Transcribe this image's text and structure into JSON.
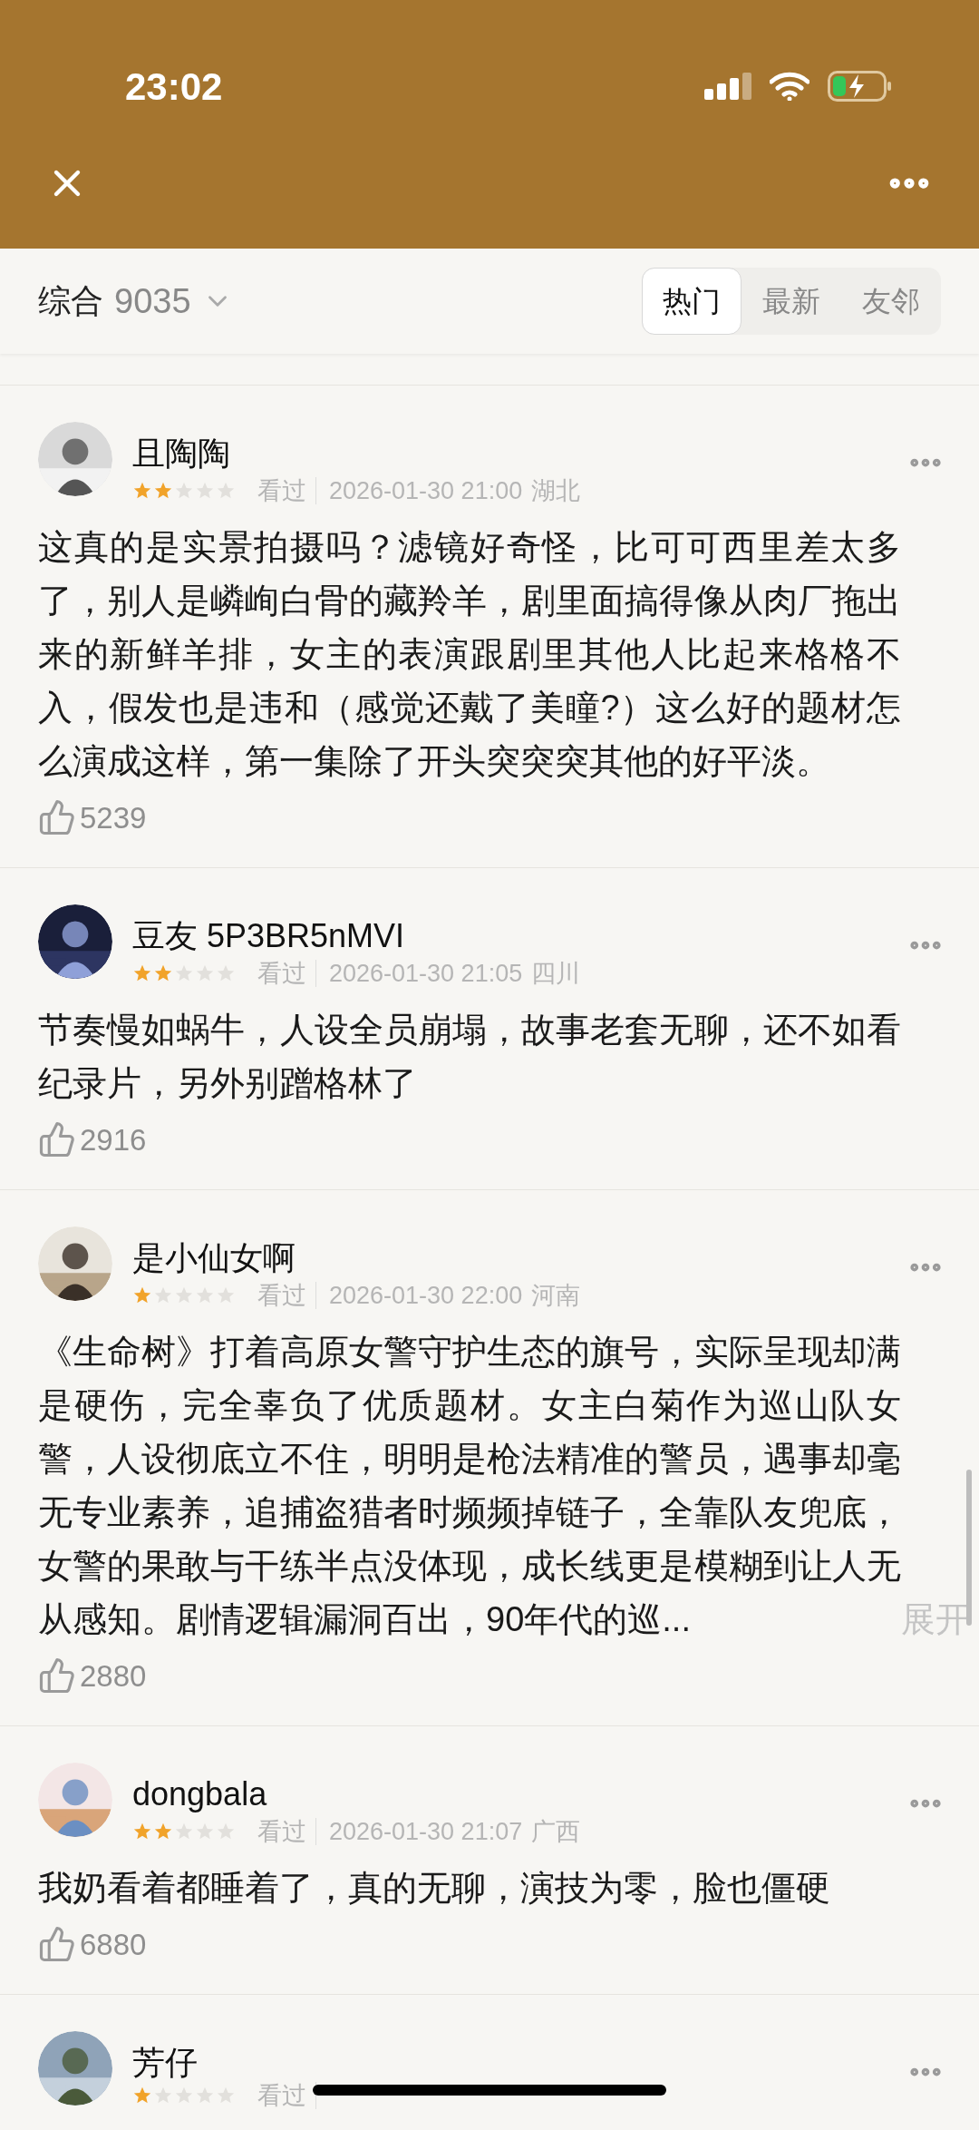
{
  "status_bar": {
    "time": "23:02"
  },
  "filter": {
    "label": "综合",
    "count": "9035",
    "tabs": [
      {
        "label": "热门",
        "selected": true
      },
      {
        "label": "最新",
        "selected": false
      },
      {
        "label": "友邻",
        "selected": false
      }
    ]
  },
  "comments": [
    {
      "user": "且陶陶",
      "stars": 2,
      "status": "看过",
      "date": "2026-01-30 21:00",
      "location": "湖北",
      "text": "这真的是实景拍摄吗？滤镜好奇怪，比可可西里差太多了，别人是嶙峋白骨的藏羚羊，剧里面搞得像从肉厂拖出来的新鲜羊排，女主的表演跟剧里其他人比起来格格不入，假发也是违和（感觉还戴了美瞳?）这么好的题材怎么演成这样，第一集除了开头突突突其他的好平淡。",
      "likes": "5239"
    },
    {
      "user": "豆友 5P3BR5nMVI",
      "stars": 2,
      "status": "看过",
      "date": "2026-01-30 21:05",
      "location": "四川",
      "text": "节奏慢如蜗牛，人设全员崩塌，故事老套无聊，还不如看纪录片，另外别蹭格林了",
      "likes": "2916"
    },
    {
      "user": "是小仙女啊",
      "stars": 1,
      "status": "看过",
      "date": "2026-01-30 22:00",
      "location": "河南",
      "text": "《生命树》打着高原女警守护生态的旗号，实际呈现却满是硬伤，完全辜负了优质题材。女主白菊作为巡山队女警，人设彻底立不住，明明是枪法精准的警员，遇事却毫无专业素养，追捕盗猎者时频频掉链子，全靠队友兜底，女警的果敢与干练半点没体现，成长线更是模糊到让人无从感知。剧情逻辑漏洞百出，90年代的巡...",
      "expand": "展开",
      "likes": "2880"
    },
    {
      "user": "dongbala",
      "stars": 2,
      "status": "看过",
      "date": "2026-01-30 21:07",
      "location": "广西",
      "text": "我奶看着都睡着了，真的无聊，演技为零，脸也僵硬",
      "likes": "6880"
    },
    {
      "user": "芳仔",
      "stars": 1,
      "status": "看过"
    }
  ]
}
